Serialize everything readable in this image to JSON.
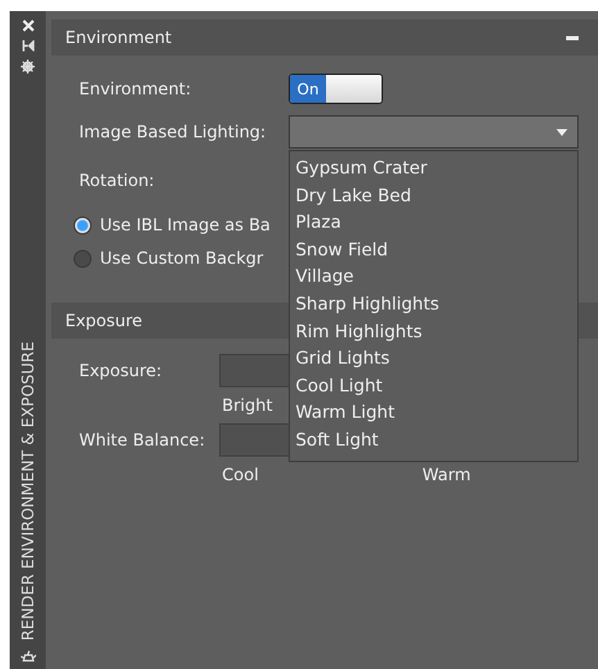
{
  "sidebar": {
    "title": "RENDER ENVIRONMENT & EXPOSURE"
  },
  "environment": {
    "title": "Environment",
    "expanded": true,
    "environment_label": "Environment:",
    "toggle": {
      "label": "On",
      "on": true
    },
    "ibl_label": "Image Based Lighting:",
    "ibl_dropdown": {
      "expanded": true,
      "options": [
        {
          "label": "Gypsum Crater",
          "selected": false
        },
        {
          "label": "Dry Lake Bed",
          "selected": false
        },
        {
          "label": "Plaza",
          "selected": false
        },
        {
          "label": "Snow Field",
          "selected": false
        },
        {
          "label": "Village",
          "selected": false
        },
        {
          "label": "Sharp Highlights",
          "selected": false
        },
        {
          "label": "Rim Highlights",
          "selected": false
        },
        {
          "label": "Grid Lights",
          "selected": false
        },
        {
          "label": "Cool Light",
          "selected": false
        },
        {
          "label": "Warm Light",
          "selected": false
        },
        {
          "label": "Soft Light",
          "selected": false
        }
      ]
    },
    "rotation_label": "Rotation:",
    "radios": [
      {
        "label": "Use IBL Image as Ba",
        "selected": true
      },
      {
        "label": "Use Custom Backgr",
        "selected": false
      }
    ]
  },
  "exposure": {
    "title": "Exposure",
    "exposure_label": "Exposure:",
    "bright_label": "Bright",
    "white_balance_label": "White Balance:",
    "cool_label": "Cool",
    "warm_label": "Warm"
  }
}
